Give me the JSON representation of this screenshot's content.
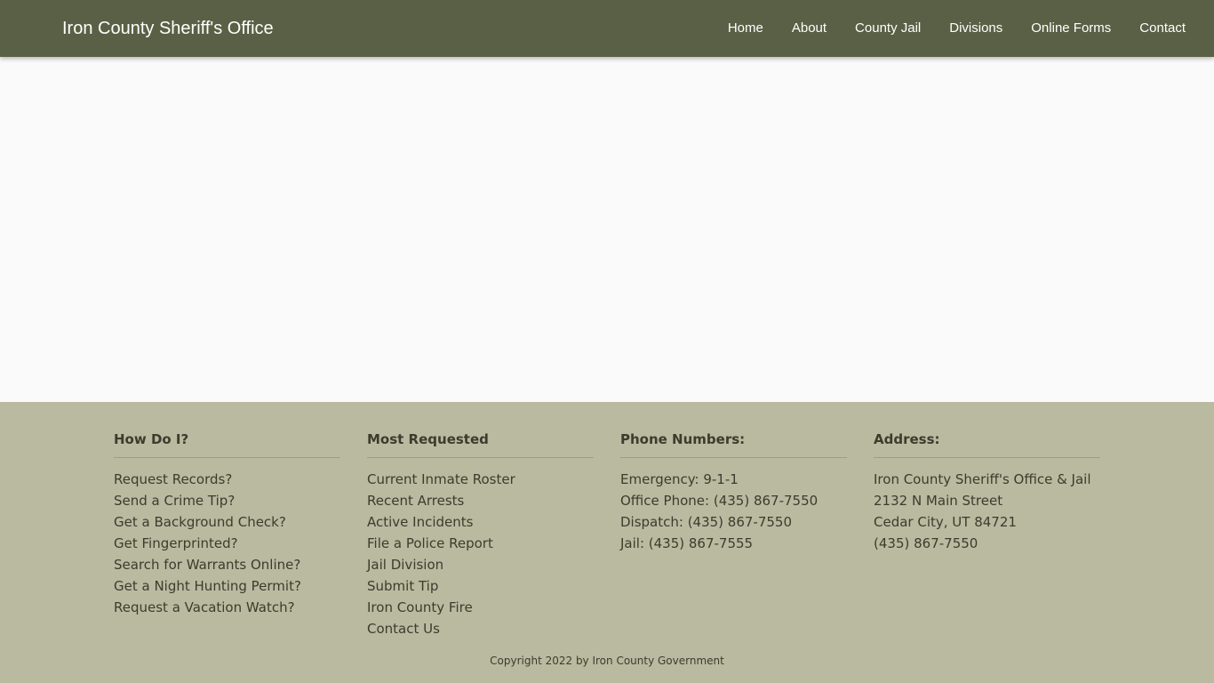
{
  "header": {
    "brand": "Iron County Sheriff's Office",
    "nav": [
      "Home",
      "About",
      "County Jail",
      "Divisions",
      "Online Forms",
      "Contact"
    ]
  },
  "footer": {
    "how_do_i": {
      "title": "How Do I?",
      "items": [
        "Request Records?",
        "Send a Crime Tip?",
        "Get a Background Check?",
        "Get Fingerprinted?",
        "Search for Warrants Online?",
        "Get a Night Hunting Permit?",
        "Request a Vacation Watch?"
      ]
    },
    "most_requested": {
      "title": "Most Requested",
      "items": [
        "Current Inmate Roster",
        "Recent Arrests",
        "Active Incidents",
        "File a Police Report",
        "Jail Division",
        "Submit Tip",
        "Iron County Fire",
        "Contact Us"
      ]
    },
    "phone_numbers": {
      "title": "Phone Numbers:",
      "items": [
        "Emergency: 9-1-1",
        "Office Phone: (435) 867-7550",
        "Dispatch: (435) 867-7550",
        "Jail: (435) 867-7555"
      ]
    },
    "address": {
      "title": "Address:",
      "lines": [
        "Iron County Sheriff's Office & Jail",
        "2132 N Main Street",
        "Cedar City, UT 84721",
        "(435) 867-7550"
      ]
    },
    "copyright": "Copyright 2022 by Iron County Government"
  },
  "colors": {
    "navbar": "#5a6045",
    "footer": "#babaa0",
    "body": "#fafafa",
    "footer_text": "#3c3c2e"
  }
}
